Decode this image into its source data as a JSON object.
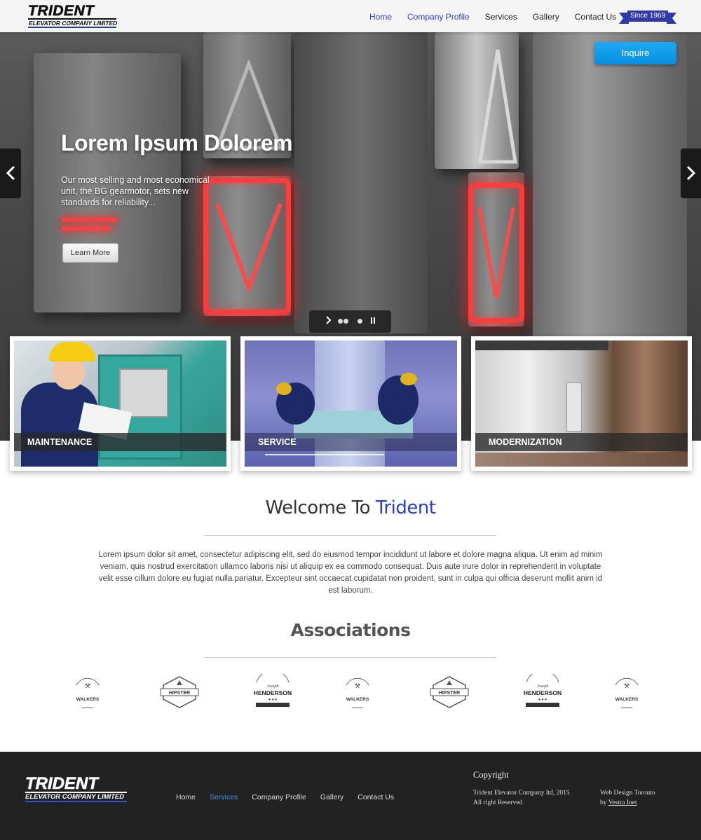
{
  "brand": {
    "name": "TRIDENT",
    "subtitle": "ELEVATOR COMPANY LIMITED"
  },
  "nav": {
    "items": [
      {
        "label": "Home",
        "active": true
      },
      {
        "label": "Company Profile",
        "active": true
      },
      {
        "label": "Services",
        "active": false
      },
      {
        "label": "Gallery",
        "active": false
      },
      {
        "label": "Contact Us",
        "active": false
      }
    ]
  },
  "since_ribbon": "Since 1969",
  "hero": {
    "title": "Lorem Ipsum Dolorem",
    "text": "Our most selling and most economical unit, the BG gearmotor, sets new standards for reliability...",
    "button_label": "Learn More",
    "inquire_label": "Inquire",
    "prev_icon": "chevron-left-icon",
    "next_icon": "chevron-right-icon"
  },
  "services": [
    {
      "caption": "MAINTENANCE"
    },
    {
      "caption": "SERVICE"
    },
    {
      "caption": "MODERNIZATION"
    }
  ],
  "welcome": {
    "title_prefix": "Welcome To ",
    "title_accent": "Trident",
    "body": "Lorem ipsum dolor sit amet, consectetur adipiscing elit, sed do eiusmod tempor incididunt ut labore et dolore magna aliqua. Ut enim ad minim veniam, quis nostrud exercitation ullamco laboris nisi ut aliquip ex ea commodo consequat. Duis aute irure dolor in reprehenderit in voluptate velit esse cillum dolore eu fugiat nulla pariatur. Excepteur sint occaecat cupidatat non proident, sunt in culpa qui officia deserunt mollit anim id est laborum."
  },
  "associations": {
    "title": "Associations",
    "logos": [
      {
        "kind": "walkers",
        "label": "WALKERS"
      },
      {
        "kind": "hipster",
        "label": "HIPSTER"
      },
      {
        "kind": "henderson",
        "label": "HENDERSON"
      },
      {
        "kind": "walkers",
        "label": "WALKERS"
      },
      {
        "kind": "hipster",
        "label": "HIPSTER"
      },
      {
        "kind": "henderson",
        "label": "HENDERSON"
      },
      {
        "kind": "walkers",
        "label": "WALKERS"
      }
    ]
  },
  "footer": {
    "nav": [
      {
        "label": "Home",
        "active": false
      },
      {
        "label": "Services",
        "active": true
      },
      {
        "label": "Company Profile",
        "active": false
      },
      {
        "label": "Gallery",
        "active": false
      },
      {
        "label": "Contact Us",
        "active": false
      }
    ],
    "copyright_title": "Copyright",
    "copyright_line1": "Trident Elevator Company ltd, 2015",
    "copyright_line2": "All right Reserved",
    "design_line1": "Web Design Toronto",
    "design_by": "by ",
    "design_link": "Vestra Inet"
  },
  "colors": {
    "accent": "#2c3fc2",
    "inquire": "#0a8fe0",
    "footer_bg": "#222222",
    "ribbon": "#2f3aa8"
  }
}
